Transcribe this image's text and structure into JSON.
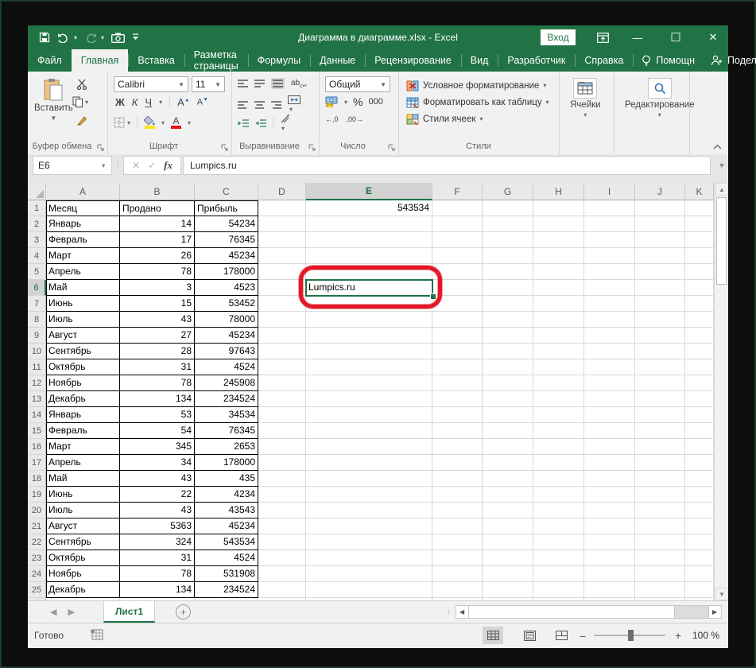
{
  "window": {
    "title": "Диаграмма в диаграмме.xlsx  -  Excel",
    "signin": "Вход",
    "minimize": "—",
    "maximize": "☐",
    "close": "✕"
  },
  "tabs": {
    "items": [
      "Файл",
      "Главная",
      "Вставка",
      "Разметка страницы",
      "Формулы",
      "Данные",
      "Рецензирование",
      "Вид",
      "Разработчик",
      "Справка"
    ],
    "active": "Главная",
    "helper": "Помощн",
    "share": "Поделиться"
  },
  "ribbon": {
    "paste": "Вставить",
    "groups": {
      "clipboard": "Буфер обмена",
      "font": "Шрифт",
      "alignment": "Выравнивание",
      "number": "Число",
      "styles": "Стили",
      "cells": "Ячейки",
      "editing": "Редактирование"
    },
    "font_name": "Calibri",
    "font_size": "11",
    "bold": "Ж",
    "italic": "К",
    "underline": "Ч",
    "grow_font": "А",
    "shrink_font": "А",
    "font_color": "А",
    "wrap_text": "ab",
    "number_format": "Общий",
    "percent": "%",
    "thousands": "000",
    "inc_decimal": "←,0",
    "dec_decimal": ",00→",
    "styles_items": [
      "Условное форматирование",
      "Форматировать как таблицу",
      "Стили ячеек"
    ],
    "cells_label": "Ячейки",
    "editing_label": "Редактирование"
  },
  "formula_bar": {
    "name_box": "E6",
    "fx": "fx",
    "value": "Lumpics.ru"
  },
  "sheet": {
    "columns": [
      "A",
      "B",
      "C",
      "D",
      "E",
      "F",
      "G",
      "H",
      "I",
      "J",
      "K"
    ],
    "selected_column": "E",
    "selected_row": 6,
    "cell_E1": "543534",
    "cell_E6": "Lumpics.ru",
    "table": {
      "headers": [
        "Месяц",
        "Продано",
        "Прибыль"
      ],
      "rows": [
        [
          "Январь",
          "14",
          "54234"
        ],
        [
          "Февраль",
          "17",
          "76345"
        ],
        [
          "Март",
          "26",
          "45234"
        ],
        [
          "Апрель",
          "78",
          "178000"
        ],
        [
          "Май",
          "3",
          "4523"
        ],
        [
          "Июнь",
          "15",
          "53452"
        ],
        [
          "Июль",
          "43",
          "78000"
        ],
        [
          "Август",
          "27",
          "45234"
        ],
        [
          "Сентябрь",
          "28",
          "97643"
        ],
        [
          "Октябрь",
          "31",
          "4524"
        ],
        [
          "Ноябрь",
          "78",
          "245908"
        ],
        [
          "Декабрь",
          "134",
          "234524"
        ],
        [
          "Январь",
          "53",
          "34534"
        ],
        [
          "Февраль",
          "54",
          "76345"
        ],
        [
          "Март",
          "345",
          "2653"
        ],
        [
          "Апрель",
          "34",
          "178000"
        ],
        [
          "Май",
          "43",
          "435"
        ],
        [
          "Июнь",
          "22",
          "4234"
        ],
        [
          "Июль",
          "43",
          "43543"
        ],
        [
          "Август",
          "5363",
          "45234"
        ],
        [
          "Сентябрь",
          "324",
          "543534"
        ],
        [
          "Октябрь",
          "31",
          "4524"
        ],
        [
          "Ноябрь",
          "78",
          "531908"
        ],
        [
          "Декабрь",
          "134",
          "234524"
        ]
      ]
    }
  },
  "sheetbar": {
    "sheet_name": "Лист1"
  },
  "statusbar": {
    "mode": "Готово",
    "zoom_level": "100 %"
  }
}
